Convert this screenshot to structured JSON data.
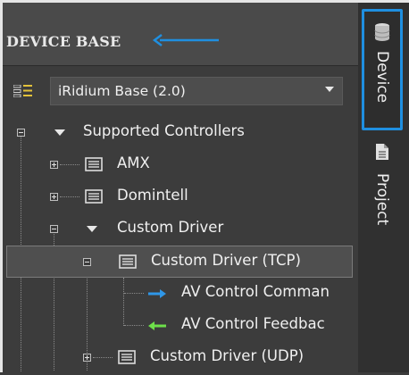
{
  "panel": {
    "title": "DEVICE BASE",
    "base_selector": {
      "value": "iRidium Base (2.0)"
    }
  },
  "tree": {
    "root": "Supported Controllers",
    "items": {
      "amx": "AMX",
      "domintell": "Domintell",
      "custom_driver": "Custom Driver",
      "custom_tcp": "Custom Driver (TCP)",
      "av_command": "AV Control Comman",
      "av_feedback": "AV Control Feedbac",
      "custom_udp": "Custom Driver (UDP)"
    }
  },
  "sidebar": {
    "tabs": [
      {
        "label": "Device",
        "icon": "database-icon",
        "active": true
      },
      {
        "label": "Project",
        "icon": "document-icon",
        "active": false
      }
    ]
  },
  "colors": {
    "accent_blue": "#1f8fe0",
    "command_arrow": "#2f97e8",
    "feedback_arrow": "#6ee04a",
    "panel_bg": "#3c3c3c"
  }
}
